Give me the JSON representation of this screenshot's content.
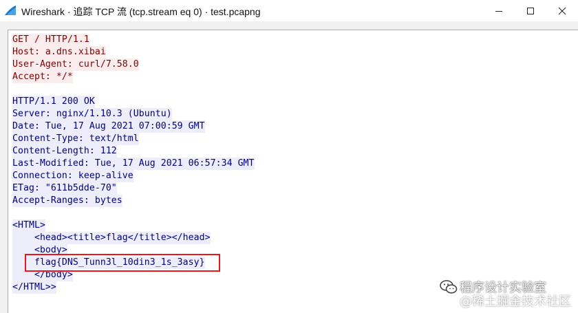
{
  "window": {
    "title": "Wireshark · 追踪 TCP 流 (tcp.stream eq 0) · test.pcapng",
    "app_icon": "wireshark-fin-icon",
    "controls": [
      "minimize-icon",
      "maximize-icon",
      "close-icon"
    ]
  },
  "stream": {
    "client_lines": [
      "GET / HTTP/1.1",
      "Host: a.dns.xibai",
      "User-Agent: curl/7.58.0",
      "Accept: */*"
    ],
    "server_lines": [
      "HTTP/1.1 200 OK",
      "Server: nginx/1.10.3 (Ubuntu)",
      "Date: Tue, 17 Aug 2021 07:00:59 GMT",
      "Content-Type: text/html",
      "Content-Length: 112",
      "Last-Modified: Tue, 17 Aug 2021 06:57:34 GMT",
      "Connection: keep-alive",
      "ETag: \"611b5dde-70\"",
      "Accept-Ranges: bytes",
      "",
      "<HTML>",
      "    <head><title>flag</title></head>",
      "    <body>",
      "    flag{DNS_Tunn3l_10din3_1s_3asy}",
      "    </body>",
      "</HTML>>"
    ],
    "client_color": "#800000",
    "client_bg": "#fbeded",
    "server_color": "#000080",
    "server_bg": "#ededfb",
    "highlight_color": "#e8161e"
  },
  "watermark": {
    "line1": "程序设计实验室",
    "line2": "@稀土掘金技术社区",
    "icon": "wechat-icon"
  }
}
